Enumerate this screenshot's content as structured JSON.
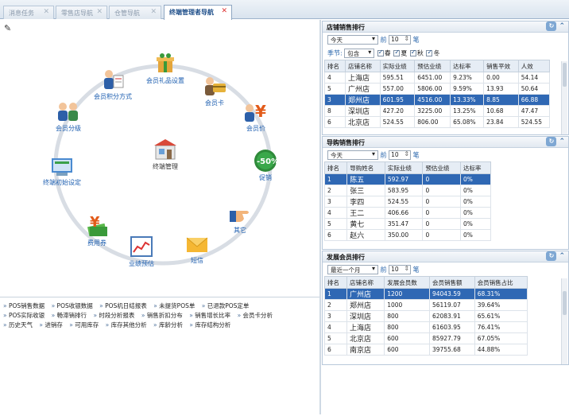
{
  "tabs": [
    {
      "label": "消息任务",
      "active": false
    },
    {
      "label": "零售店导航",
      "active": false
    },
    {
      "label": "仓管导航",
      "active": false
    },
    {
      "label": "终端管理者导航",
      "active": true
    }
  ],
  "diagram": {
    "center": "终端管理",
    "nodes": {
      "gift": "会员礼品设置",
      "points": "会员积分方式",
      "card": "会员卡",
      "grade": "会员分级",
      "price": "会员价",
      "init": "终端初始设定",
      "promo": "促销",
      "expense": "费用券",
      "other": "其它",
      "perf": "业绩预估",
      "sms": "短信"
    }
  },
  "links": [
    "POS销售数据",
    "POS收银数据",
    "POS机日结报表",
    "未提货POS单",
    "已退款POS定单",
    "POS实际收银",
    "畅滞销排行",
    "时段分析报表",
    "销售折扣分布",
    "销售增长比率",
    "会员卡分析",
    "历史天气",
    "进销存",
    "可用库存",
    "库存其他分析",
    "库龄分析",
    "库存结构分析"
  ],
  "store_rank": {
    "title": "店铺销售排行",
    "period": "今天",
    "top_prefix": "前",
    "top_n": "10",
    "top_suffix": "笔",
    "season_label": "季节:",
    "season_value": "包含",
    "seasons": [
      "春",
      "夏",
      "秋",
      "冬"
    ],
    "headers": [
      "排名",
      "店铺名称",
      "实际业绩",
      "预估业绩",
      "达标率",
      "销售平效",
      "人效"
    ],
    "rows": [
      [
        "4",
        "上海店",
        "595.51",
        "6451.00",
        "9.23%",
        "0.00",
        "54.14"
      ],
      [
        "5",
        "广州店",
        "557.00",
        "5806.00",
        "9.59%",
        "13.93",
        "50.64"
      ],
      [
        "3",
        "郑州店",
        "601.95",
        "4516.00",
        "13.33%",
        "8.85",
        "66.88"
      ],
      [
        "8",
        "深圳店",
        "427.20",
        "3225.00",
        "13.25%",
        "10.68",
        "47.47"
      ],
      [
        "6",
        "北京店",
        "524.55",
        "806.00",
        "65.08%",
        "23.84",
        "524.55"
      ]
    ],
    "selected_row": 2
  },
  "guide_rank": {
    "title": "导购销售排行",
    "period": "今天",
    "top_prefix": "前",
    "top_n": "10",
    "top_suffix": "笔",
    "headers": [
      "排名",
      "导购姓名",
      "实际业绩",
      "预估业绩",
      "达标率"
    ],
    "rows": [
      [
        "1",
        "陈五",
        "592.97",
        "0",
        "0%"
      ],
      [
        "2",
        "张三",
        "583.95",
        "0",
        "0%"
      ],
      [
        "3",
        "李四",
        "524.55",
        "0",
        "0%"
      ],
      [
        "4",
        "王二",
        "406.66",
        "0",
        "0%"
      ],
      [
        "5",
        "黄七",
        "351.47",
        "0",
        "0%"
      ],
      [
        "6",
        "赵六",
        "350.00",
        "0",
        "0%"
      ]
    ],
    "selected_row": 0
  },
  "member_rank": {
    "title": "发展会员排行",
    "period": "最近一个月",
    "top_prefix": "前",
    "top_n": "10",
    "top_suffix": "笔",
    "headers": [
      "排名",
      "店铺名称",
      "发展会员数",
      "会员销售额",
      "会员销售占比"
    ],
    "rows": [
      [
        "1",
        "广州店",
        "1200",
        "94043.59",
        "68.31%"
      ],
      [
        "2",
        "郑州店",
        "1000",
        "56119.07",
        "39.64%"
      ],
      [
        "3",
        "深圳店",
        "800",
        "62083.91",
        "65.61%"
      ],
      [
        "4",
        "上海店",
        "800",
        "61603.95",
        "76.41%"
      ],
      [
        "5",
        "北京店",
        "600",
        "85927.79",
        "67.05%"
      ],
      [
        "6",
        "南京店",
        "600",
        "39755.68",
        "44.88%"
      ]
    ],
    "selected_row": 0
  }
}
